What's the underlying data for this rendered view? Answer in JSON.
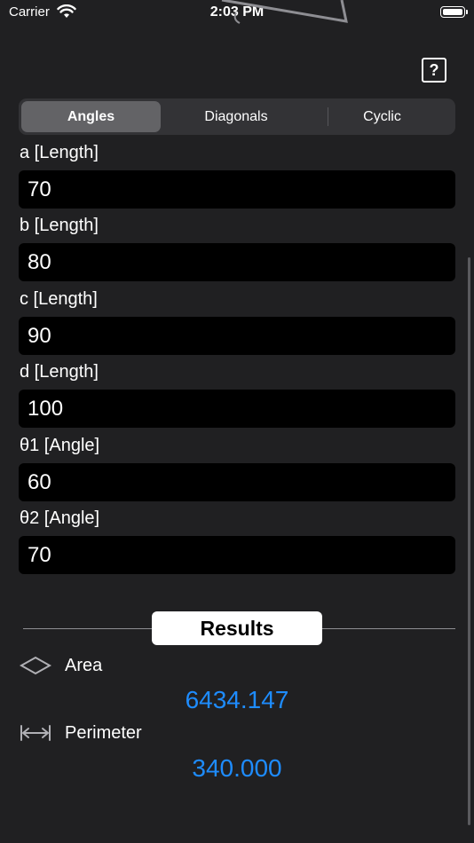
{
  "status": {
    "carrier": "Carrier",
    "time": "2:03 PM"
  },
  "help": {
    "label": "?"
  },
  "tabs": [
    {
      "label": "Angles",
      "selected": true
    },
    {
      "label": "Diagonals",
      "selected": false
    },
    {
      "label": "Cyclic",
      "selected": false
    }
  ],
  "fields": [
    {
      "label": "a [Length]",
      "value": "70"
    },
    {
      "label": "b [Length]",
      "value": "80"
    },
    {
      "label": "c [Length]",
      "value": "90"
    },
    {
      "label": "d [Length]",
      "value": "100"
    },
    {
      "label": "θ1 [Angle]",
      "value": "60"
    },
    {
      "label": "θ2 [Angle]",
      "value": "70"
    }
  ],
  "results": {
    "heading": "Results",
    "area": {
      "label": "Area",
      "value": "6434.147",
      "icon": "diamond-icon"
    },
    "perimeter": {
      "label": "Perimeter",
      "value": "340.000",
      "icon": "width-arrows-icon"
    }
  },
  "colors": {
    "background": "#202022",
    "accent": "#1e8cff",
    "input_bg": "#000000"
  }
}
